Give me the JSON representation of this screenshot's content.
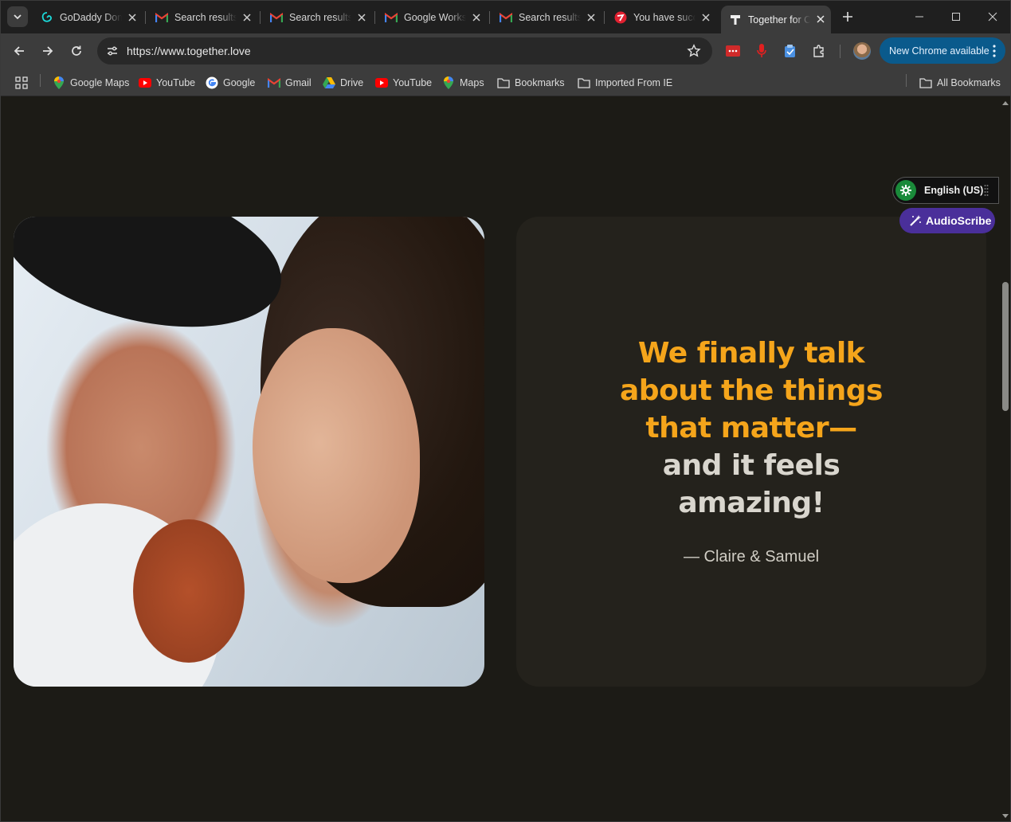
{
  "browser": {
    "tabs": [
      {
        "title": "GoDaddy Domain",
        "icon": "godaddy-icon",
        "active": false
      },
      {
        "title": "Search results",
        "icon": "gmail-icon",
        "active": false
      },
      {
        "title": "Search results",
        "icon": "gmail-icon",
        "active": false
      },
      {
        "title": "Google Workspace",
        "icon": "gmail-icon",
        "active": false
      },
      {
        "title": "Search results",
        "icon": "gmail-icon",
        "active": false
      },
      {
        "title": "You have successfully",
        "icon": "red-circle-icon",
        "active": false
      },
      {
        "title": "Together for Couples",
        "icon": "together-icon",
        "active": true
      }
    ],
    "url": "https://www.together.love",
    "update_button": "New Chrome available",
    "bookmarks": [
      {
        "label": "Google Maps",
        "icon": "maps-pin-icon"
      },
      {
        "label": "YouTube",
        "icon": "youtube-icon"
      },
      {
        "label": "Google",
        "icon": "google-g-icon"
      },
      {
        "label": "Gmail",
        "icon": "gmail-icon"
      },
      {
        "label": "Drive",
        "icon": "drive-icon"
      },
      {
        "label": "YouTube",
        "icon": "youtube-icon"
      },
      {
        "label": "Maps",
        "icon": "maps-pin-icon"
      },
      {
        "label": "Bookmarks",
        "icon": "folder-icon"
      },
      {
        "label": "Imported From IE",
        "icon": "folder-icon"
      }
    ],
    "all_bookmarks": "All Bookmarks",
    "colors": {
      "accent_blue": "#0a5a8c",
      "tab_active": "#3c3c3c",
      "frame": "#1f1f1f"
    }
  },
  "page": {
    "photo_alt": "Couple touching foreheads and smiling",
    "quote": {
      "highlight_lines": [
        "We finally talk",
        "about the things",
        "that matter—"
      ],
      "plain_lines": [
        "and it feels",
        "amazing!"
      ],
      "author": "— Claire & Samuel"
    },
    "colors": {
      "background": "#1c1b16",
      "card": "#24221c",
      "highlight": "#f5a51b",
      "text": "#d9d6ce"
    }
  },
  "overlays": {
    "language": "English (US)",
    "audioscribe": "AudioScribe"
  }
}
